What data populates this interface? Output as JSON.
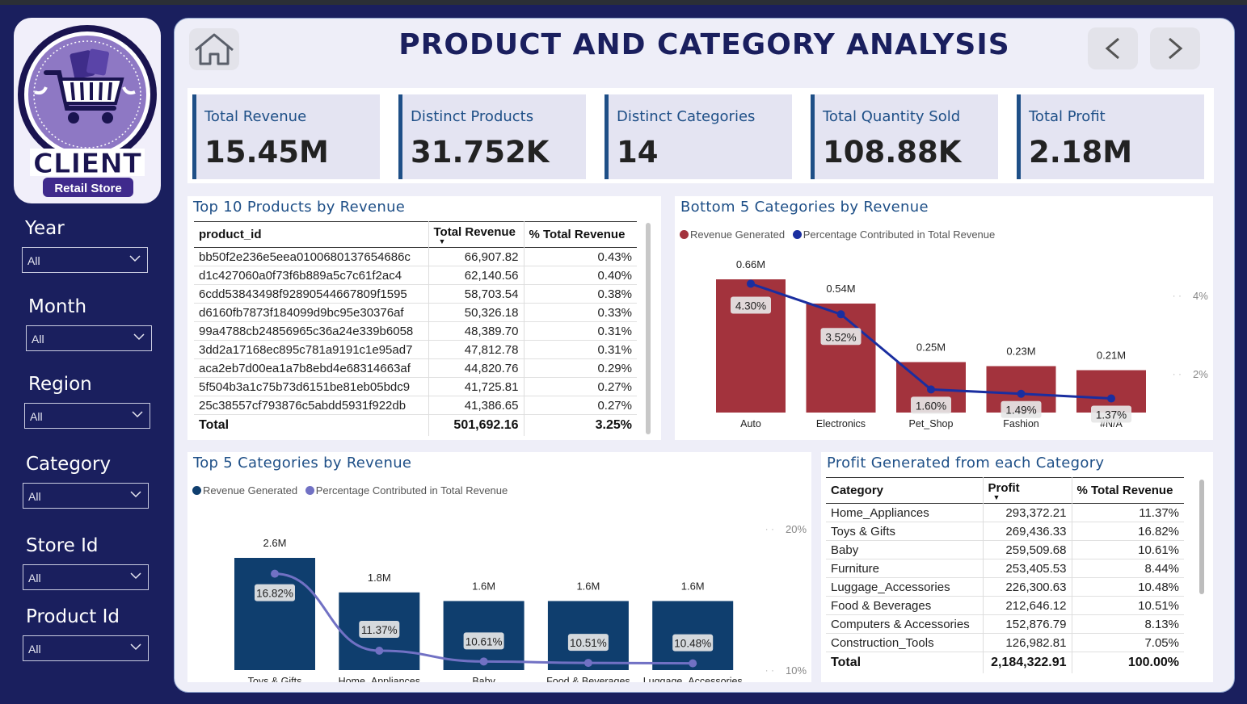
{
  "app": {
    "title": "PRODUCT AND CATEGORY ANALYSIS",
    "logo": {
      "brand": "CLIENT",
      "subtitle": "Retail Store"
    }
  },
  "filters": [
    {
      "label": "Year",
      "value": "All"
    },
    {
      "label": "Month",
      "value": "All"
    },
    {
      "label": "Region",
      "value": "All"
    },
    {
      "label": "Category",
      "value": "All"
    },
    {
      "label": "Store Id",
      "value": "All"
    },
    {
      "label": "Product Id",
      "value": "All"
    }
  ],
  "kpis": [
    {
      "label": "Total Revenue",
      "value": "15.45M"
    },
    {
      "label": "Distinct Products",
      "value": "31.752K"
    },
    {
      "label": "Distinct Categories",
      "value": "14"
    },
    {
      "label": "Total Quantity Sold",
      "value": "108.88K"
    },
    {
      "label": "Total Profit",
      "value": "2.18M"
    }
  ],
  "top_products": {
    "title": "Top 10 Products by Revenue",
    "columns": [
      "product_id",
      "Total Revenue",
      "% Total Revenue"
    ],
    "rows": [
      [
        "bb50f2e236e5eea0100680137654686c",
        "66,907.82",
        "0.43%"
      ],
      [
        "d1c427060a0f73f6b889a5c7c61f2ac4",
        "62,140.56",
        "0.40%"
      ],
      [
        "6cdd53843498f92890544667809f1595",
        "58,703.54",
        "0.38%"
      ],
      [
        "d6160fb7873f184099d9bc95e30376af",
        "50,326.18",
        "0.33%"
      ],
      [
        "99a4788cb24856965c36a24e339b6058",
        "48,389.70",
        "0.31%"
      ],
      [
        "3dd2a17168ec895c781a9191c1e95ad7",
        "47,812.78",
        "0.31%"
      ],
      [
        "aca2eb7d00ea1a7b8ebd4e68314663af",
        "44,820.76",
        "0.29%"
      ],
      [
        "5f504b3a1c75b73d6151be81eb05bdc9",
        "41,725.81",
        "0.27%"
      ],
      [
        "25c38557cf793876c5abdd5931f922db",
        "41,386.65",
        "0.27%"
      ]
    ],
    "total": [
      "Total",
      "501,692.16",
      "3.25%"
    ]
  },
  "profit_table": {
    "title": "Profit Generated from each Category",
    "columns": [
      "Category",
      "Profit",
      "% Total Revenue"
    ],
    "rows": [
      [
        "Home_Appliances",
        "293,372.21",
        "11.37%"
      ],
      [
        "Toys & Gifts",
        "269,436.33",
        "16.82%"
      ],
      [
        "Baby",
        "259,509.68",
        "10.61%"
      ],
      [
        "Furniture",
        "253,405.53",
        "8.44%"
      ],
      [
        "Luggage_Accessories",
        "226,300.63",
        "10.48%"
      ],
      [
        "Food & Beverages",
        "212,646.12",
        "10.51%"
      ],
      [
        "Computers & Accessories",
        "152,876.79",
        "8.13%"
      ],
      [
        "Construction_Tools",
        "126,982.81",
        "7.05%"
      ]
    ],
    "total": [
      "Total",
      "2,184,322.91",
      "100.00%"
    ]
  },
  "chart_data": [
    {
      "type": "bar",
      "title": "Bottom 5 Categories by Revenue",
      "categories": [
        "Auto",
        "Electronics",
        "Pet_Shop",
        "Fashion",
        "#N/A"
      ],
      "series": [
        {
          "name": "Revenue Generated",
          "values": [
            0.66,
            0.54,
            0.25,
            0.23,
            0.21
          ],
          "labels": [
            "0.66M",
            "0.54M",
            "0.25M",
            "0.23M",
            "0.21M"
          ],
          "color": "#a3333d"
        },
        {
          "name": "Percentage Contributed in Total Revenue",
          "values": [
            4.3,
            3.52,
            1.6,
            1.49,
            1.37
          ],
          "labels": [
            "4.30%",
            "3.52%",
            "1.60%",
            "1.49%",
            "1.37%"
          ],
          "color": "#1a2ea0"
        }
      ],
      "y2_ticks": [
        "4%",
        "2%"
      ],
      "y2_tick_values": [
        4,
        2
      ],
      "legend": "top-left"
    },
    {
      "type": "bar",
      "title": "Top 5 Categories by Revenue",
      "categories": [
        "Toys & Gifts",
        "Home_Appliances",
        "Baby",
        "Food & Beverages",
        "Luggage_Accessories"
      ],
      "series": [
        {
          "name": "Revenue Generated",
          "values": [
            2.6,
            1.8,
            1.6,
            1.6,
            1.6
          ],
          "labels": [
            "2.6M",
            "1.8M",
            "1.6M",
            "1.6M",
            "1.6M"
          ],
          "color": "#0f3e6e"
        },
        {
          "name": "Percentage Contributed in Total Revenue",
          "values": [
            16.82,
            11.37,
            10.61,
            10.51,
            10.48
          ],
          "labels": [
            "16.82%",
            "11.37%",
            "10.61%",
            "10.51%",
            "10.48%"
          ],
          "color": "#7171c4"
        }
      ],
      "y2_ticks": [
        "20%",
        "10%"
      ],
      "y2_tick_values": [
        20,
        10
      ],
      "legend": "top-left"
    }
  ]
}
